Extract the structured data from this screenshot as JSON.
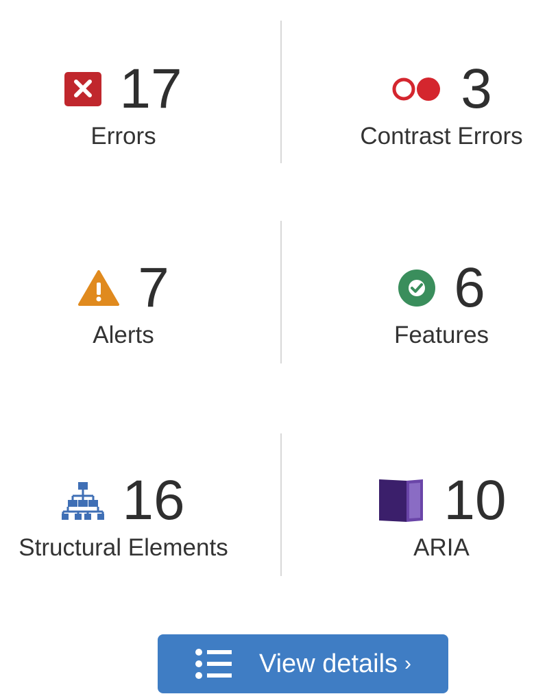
{
  "summary": {
    "errors": {
      "count": "17",
      "label": "Errors",
      "icon": "error-x-icon",
      "color": "#c0272d"
    },
    "contrast_errors": {
      "count": "3",
      "label": "Contrast Errors",
      "icon": "contrast-circles-icon",
      "color": "#d4262e"
    },
    "alerts": {
      "count": "7",
      "label": "Alerts",
      "icon": "warning-triangle-icon",
      "color": "#e08a1e"
    },
    "features": {
      "count": "6",
      "label": "Features",
      "icon": "check-circle-icon",
      "color": "#3a8e5c"
    },
    "structural": {
      "count": "16",
      "label": "Structural Elements",
      "icon": "hierarchy-icon",
      "color": "#3f6fb5"
    },
    "aria": {
      "count": "10",
      "label": "ARIA",
      "icon": "aria-box-icon",
      "color": "#4a2a7e"
    }
  },
  "button": {
    "label": "View details",
    "chevron": "›",
    "icon": "list-icon",
    "color": "#3f7dc4"
  }
}
